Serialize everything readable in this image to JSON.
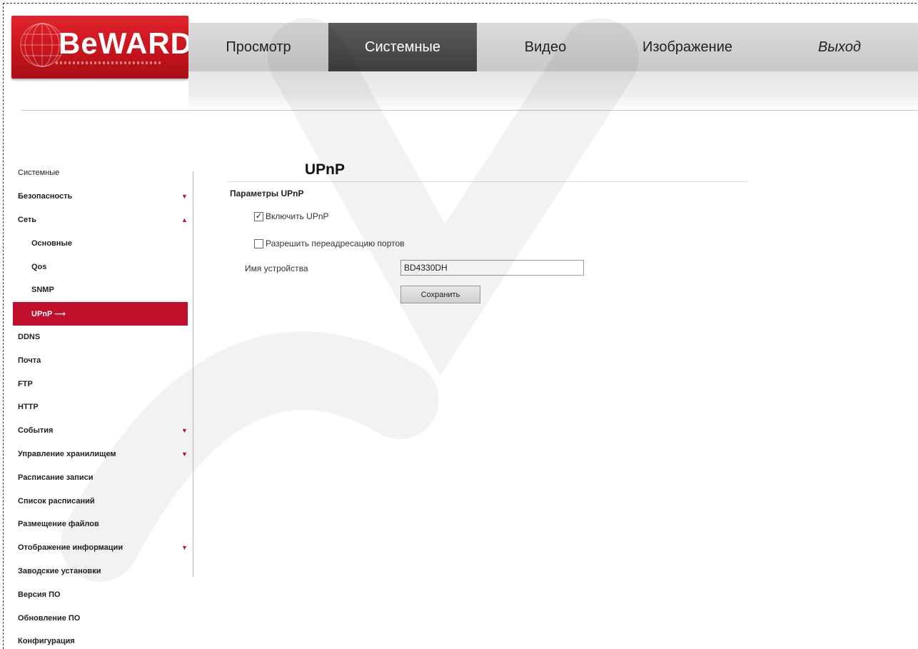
{
  "brand": {
    "logo_text": "BeWARD",
    "logo_color": "#c8141d"
  },
  "topnav": {
    "items": [
      {
        "label": "Просмотр",
        "active": false
      },
      {
        "label": "Системные",
        "active": true
      },
      {
        "label": "Видео",
        "active": false
      },
      {
        "label": "Изображение",
        "active": false
      },
      {
        "label": "Выход",
        "active": false
      }
    ]
  },
  "sidebar": {
    "items": [
      {
        "label": "Системные"
      },
      {
        "label": "Безопасность",
        "arrow": "▼"
      },
      {
        "label": "Сеть",
        "arrow": "▲"
      },
      {
        "label": "Основные"
      },
      {
        "label": "Qos"
      },
      {
        "label": "SNMP"
      },
      {
        "label": "UPnP ⟶"
      },
      {
        "label": "DDNS"
      },
      {
        "label": "Почта"
      },
      {
        "label": "FTP"
      },
      {
        "label": "HTTP"
      },
      {
        "label": "События",
        "arrow": "▼"
      },
      {
        "label": "Управление хранилищем",
        "arrow": "▼"
      },
      {
        "label": "Расписание записи"
      },
      {
        "label": "Список расписаний"
      },
      {
        "label": "Размещение файлов"
      },
      {
        "label": "Отображение информации",
        "arrow": "▼"
      },
      {
        "label": "Заводские установки"
      },
      {
        "label": "Версия ПО"
      },
      {
        "label": "Обновление ПО"
      },
      {
        "label": "Конфигурация"
      }
    ],
    "active_index": 6,
    "accent_color": "#c0102c"
  },
  "main": {
    "title": "UPnP",
    "section_label": "Параметры UPnP",
    "enable_upnp": {
      "label": "Включить UPnP",
      "checked": true
    },
    "port_forwarding": {
      "label": "Разрешить переадресацию портов",
      "checked": false
    },
    "device_name": {
      "label": "Имя устройства",
      "value": "BD4330DH"
    },
    "save_label": "Сохранить"
  }
}
